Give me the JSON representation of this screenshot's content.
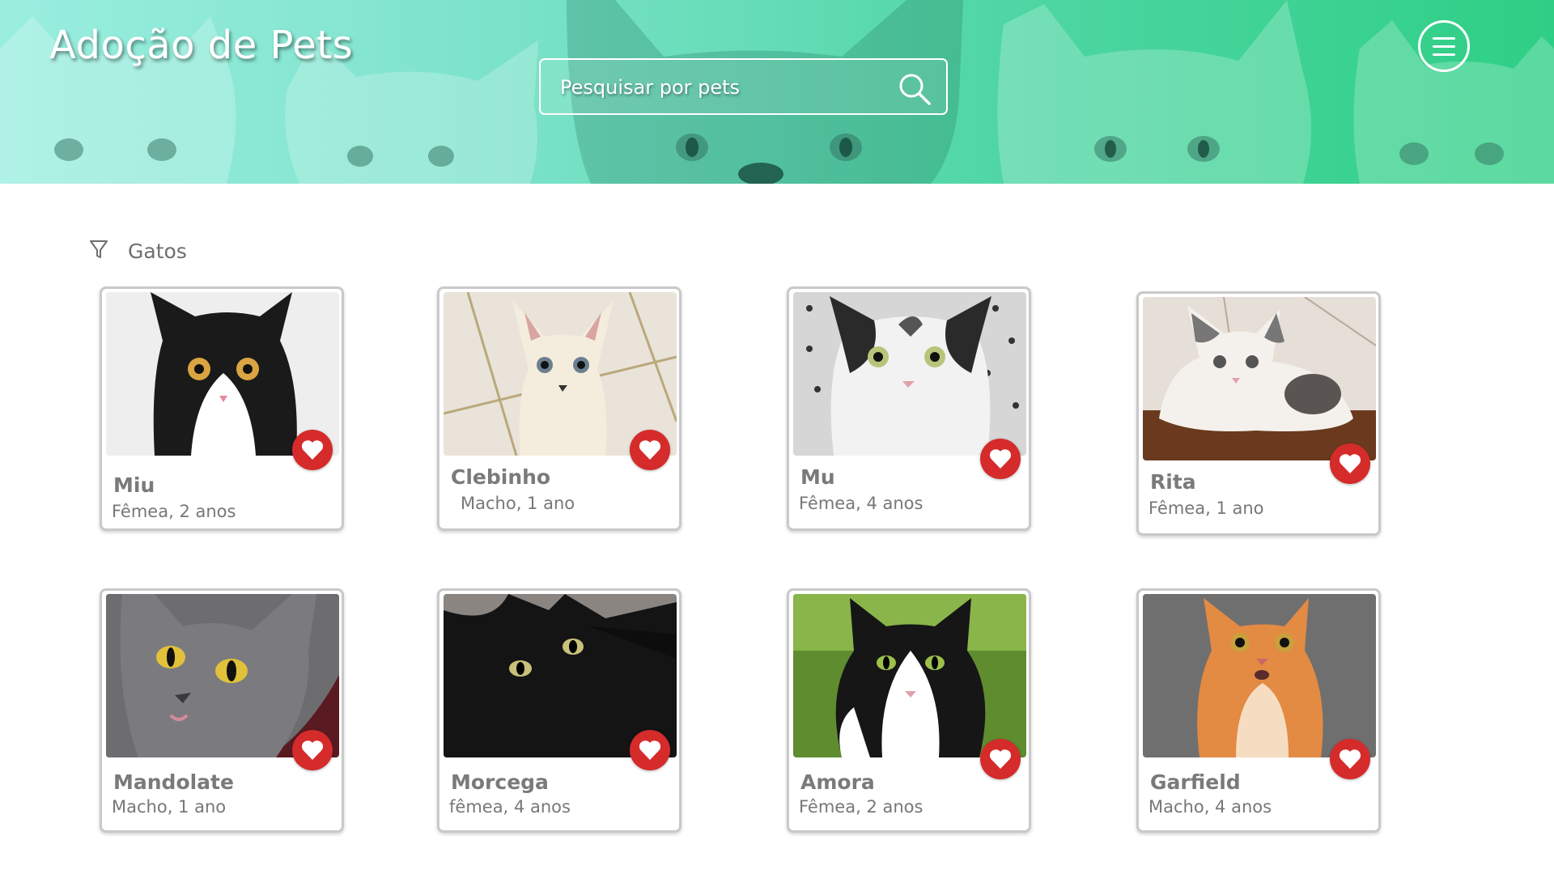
{
  "header": {
    "title": "Adoção de Pets",
    "search_placeholder": "Pesquisar por pets"
  },
  "filter": {
    "label": "Gatos"
  },
  "colors": {
    "header_gradient_start": "#9aeedf",
    "header_gradient_end": "#2ecf85",
    "favorite_button": "#d52b2b",
    "card_border": "#c9c9c9",
    "text_gray": "#7a7a7a"
  },
  "icons": {
    "search": "search-icon",
    "menu": "hamburger-menu-icon",
    "filter": "funnel-filter-icon",
    "favorite": "heart-icon"
  },
  "pets": [
    {
      "name": "Miu",
      "info": "Fêmea, 2 anos"
    },
    {
      "name": "Clebinho",
      "info": "Macho, 1 ano"
    },
    {
      "name": "Mu",
      "info": "Fêmea, 4 anos"
    },
    {
      "name": "Rita",
      "info": "Fêmea, 1 ano"
    },
    {
      "name": "Mandolate",
      "info": "Macho, 1 ano"
    },
    {
      "name": "Morcega",
      "info": "fêmea, 4 anos"
    },
    {
      "name": "Amora",
      "info": "Fêmea, 2 anos"
    },
    {
      "name": "Garfield",
      "info": "Macho, 4 anos"
    }
  ]
}
